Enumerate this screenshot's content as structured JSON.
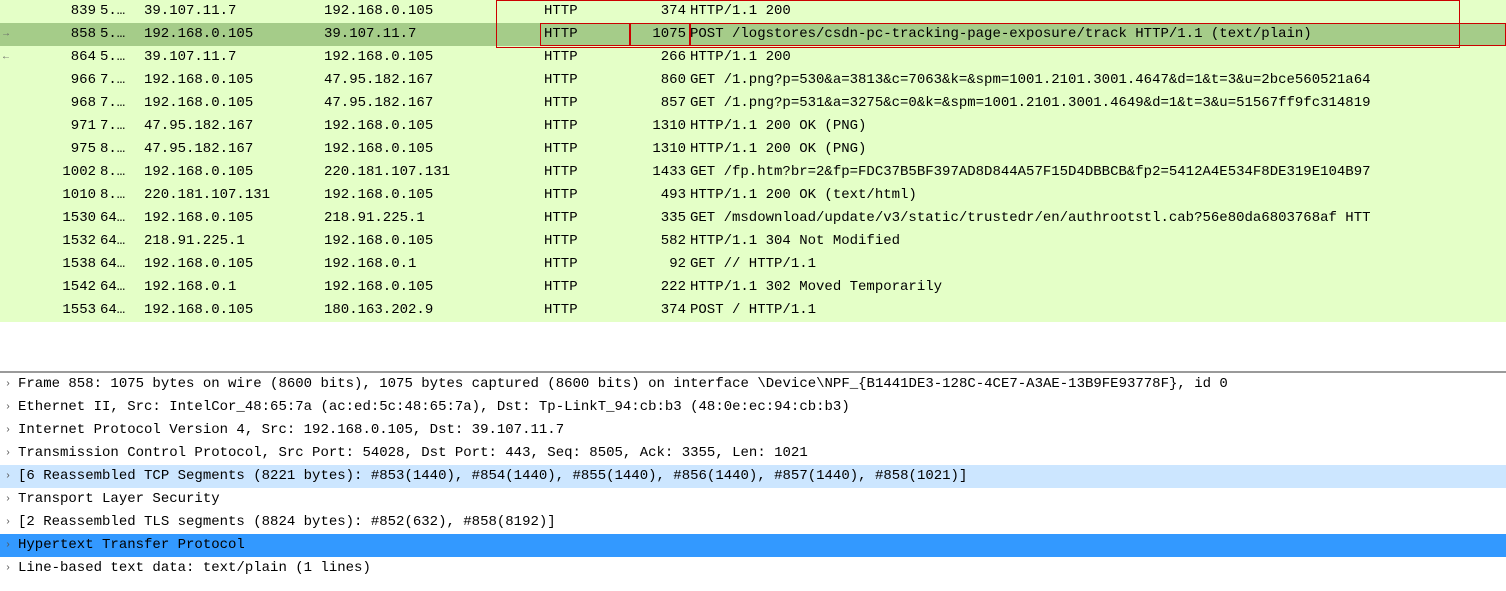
{
  "packets": [
    {
      "no": "839",
      "time": "5.…",
      "src": "39.107.11.7",
      "dst": "192.168.0.105",
      "proto": "HTTP",
      "len": "374",
      "info": "HTTP/1.1 200 ",
      "sel": false,
      "first": true
    },
    {
      "no": "858",
      "time": "5.…",
      "src": "192.168.0.105",
      "dst": "39.107.11.7",
      "proto": "HTTP",
      "len": "1075",
      "info": "POST /logstores/csdn-pc-tracking-page-exposure/track HTTP/1.1  (text/plain)",
      "sel": true
    },
    {
      "no": "864",
      "time": "5.…",
      "src": "39.107.11.7",
      "dst": "192.168.0.105",
      "proto": "HTTP",
      "len": "266",
      "info": "HTTP/1.1 200 ",
      "sel": false,
      "arrow2": true
    },
    {
      "no": "966",
      "time": "7.…",
      "src": "192.168.0.105",
      "dst": "47.95.182.167",
      "proto": "HTTP",
      "len": "860",
      "info": "GET /1.png?p=530&a=3813&c=7063&k=&spm=1001.2101.3001.4647&d=1&t=3&u=2bce560521a64"
    },
    {
      "no": "968",
      "time": "7.…",
      "src": "192.168.0.105",
      "dst": "47.95.182.167",
      "proto": "HTTP",
      "len": "857",
      "info": "GET /1.png?p=531&a=3275&c=0&k=&spm=1001.2101.3001.4649&d=1&t=3&u=51567ff9fc314819"
    },
    {
      "no": "971",
      "time": "7.…",
      "src": "47.95.182.167",
      "dst": "192.168.0.105",
      "proto": "HTTP",
      "len": "1310",
      "info": "HTTP/1.1 200 OK  (PNG)"
    },
    {
      "no": "975",
      "time": "8.…",
      "src": "47.95.182.167",
      "dst": "192.168.0.105",
      "proto": "HTTP",
      "len": "1310",
      "info": "HTTP/1.1 200 OK  (PNG)"
    },
    {
      "no": "1002",
      "time": "8.…",
      "src": "192.168.0.105",
      "dst": "220.181.107.131",
      "proto": "HTTP",
      "len": "1433",
      "info": "GET /fp.htm?br=2&fp=FDC37B5BF397AD8D844A57F15D4DBBCB&fp2=5412A4E534F8DE319E104B97"
    },
    {
      "no": "1010",
      "time": "8.…",
      "src": "220.181.107.131",
      "dst": "192.168.0.105",
      "proto": "HTTP",
      "len": "493",
      "info": "HTTP/1.1 200 OK  (text/html)"
    },
    {
      "no": "1530",
      "time": "64…",
      "src": "192.168.0.105",
      "dst": "218.91.225.1",
      "proto": "HTTP",
      "len": "335",
      "info": "GET /msdownload/update/v3/static/trustedr/en/authrootstl.cab?56e80da6803768af HTT"
    },
    {
      "no": "1532",
      "time": "64…",
      "src": "218.91.225.1",
      "dst": "192.168.0.105",
      "proto": "HTTP",
      "len": "582",
      "info": "HTTP/1.1 304 Not Modified "
    },
    {
      "no": "1538",
      "time": "64…",
      "src": "192.168.0.105",
      "dst": "192.168.0.1",
      "proto": "HTTP",
      "len": "92",
      "info": "GET // HTTP/1.1 "
    },
    {
      "no": "1542",
      "time": "64…",
      "src": "192.168.0.1",
      "dst": "192.168.0.105",
      "proto": "HTTP",
      "len": "222",
      "info": "HTTP/1.1 302 Moved Temporarily "
    },
    {
      "no": "1553",
      "time": "64…",
      "src": "192.168.0.105",
      "dst": "180.163.202.9",
      "proto": "HTTP",
      "len": "374",
      "info": "POST / HTTP/1.1 "
    }
  ],
  "tree": [
    {
      "t": "Frame 858: 1075 bytes on wire (8600 bits), 1075 bytes captured (8600 bits) on interface \\Device\\NPF_{B1441DE3-128C-4CE7-A3AE-13B9FE93778F}, id 0",
      "cls": ""
    },
    {
      "t": "Ethernet II, Src: IntelCor_48:65:7a (ac:ed:5c:48:65:7a), Dst: Tp-LinkT_94:cb:b3 (48:0e:ec:94:cb:b3)",
      "cls": ""
    },
    {
      "t": "Internet Protocol Version 4, Src: 192.168.0.105, Dst: 39.107.11.7",
      "cls": ""
    },
    {
      "t": "Transmission Control Protocol, Src Port: 54028, Dst Port: 443, Seq: 8505, Ack: 3355, Len: 1021",
      "cls": ""
    },
    {
      "t": "[6 Reassembled TCP Segments (8221 bytes): #853(1440), #854(1440), #855(1440), #856(1440), #857(1440), #858(1021)]",
      "cls": "hl-blue"
    },
    {
      "t": "Transport Layer Security",
      "cls": ""
    },
    {
      "t": "[2 Reassembled TLS segments (8824 bytes): #852(632), #858(8192)]",
      "cls": ""
    },
    {
      "t": "Hypertext Transfer Protocol",
      "cls": "hl-sel"
    },
    {
      "t": "Line-based text data: text/plain (1 lines)",
      "cls": ""
    }
  ]
}
